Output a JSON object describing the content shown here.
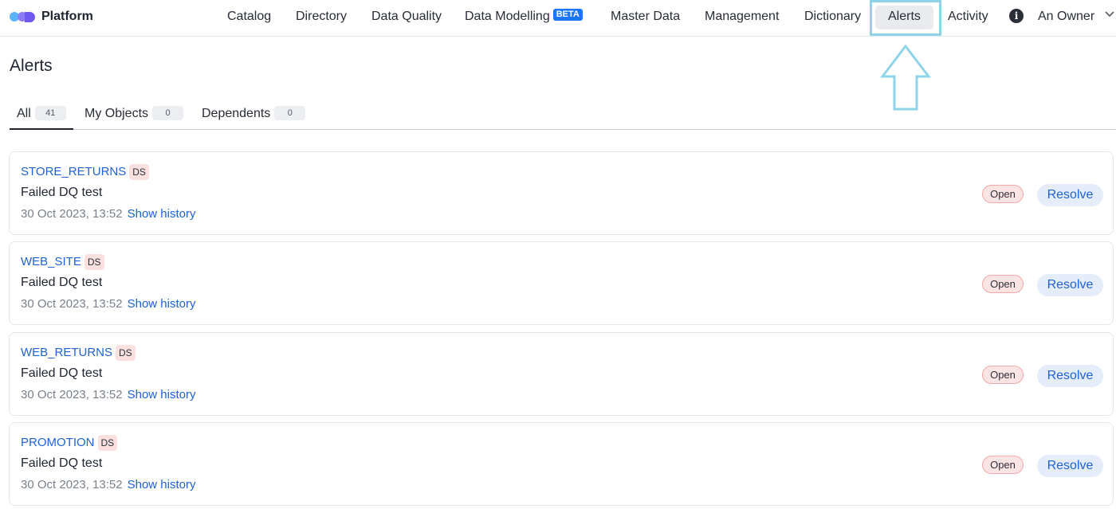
{
  "app": {
    "name": "Platform"
  },
  "nav": {
    "items": [
      {
        "label": "Catalog"
      },
      {
        "label": "Directory"
      },
      {
        "label": "Data Quality"
      },
      {
        "label": "Data Modelling",
        "badge": "BETA"
      },
      {
        "label": "Master Data"
      },
      {
        "label": "Management"
      },
      {
        "label": "Dictionary"
      },
      {
        "label": "Alerts",
        "selected": true
      },
      {
        "label": "Activity"
      }
    ],
    "info_icon": "i",
    "user": "An Owner"
  },
  "page": {
    "title": "Alerts"
  },
  "tabs": [
    {
      "label": "All",
      "count": "41",
      "active": true
    },
    {
      "label": "My Objects",
      "count": "0"
    },
    {
      "label": "Dependents",
      "count": "0"
    }
  ],
  "alerts": [
    {
      "name": "STORE_RETURNS",
      "type": "DS",
      "description": "Failed DQ test",
      "timestamp": "30 Oct 2023, 13:52",
      "history_label": "Show history",
      "status": "Open",
      "action": "Resolve"
    },
    {
      "name": "WEB_SITE",
      "type": "DS",
      "description": "Failed DQ test",
      "timestamp": "30 Oct 2023, 13:52",
      "history_label": "Show history",
      "status": "Open",
      "action": "Resolve"
    },
    {
      "name": "WEB_RETURNS",
      "type": "DS",
      "description": "Failed DQ test",
      "timestamp": "30 Oct 2023, 13:52",
      "history_label": "Show history",
      "status": "Open",
      "action": "Resolve"
    },
    {
      "name": "PROMOTION",
      "type": "DS",
      "description": "Failed DQ test",
      "timestamp": "30 Oct 2023, 13:52",
      "history_label": "Show history",
      "status": "Open",
      "action": "Resolve"
    }
  ],
  "colors": {
    "accent": "#1f62d6",
    "beta_badge": "#1976ff",
    "status_open_bg": "#fde4e4",
    "ds_badge_bg": "#fbe0e0",
    "highlight": "#8fd3e8"
  }
}
